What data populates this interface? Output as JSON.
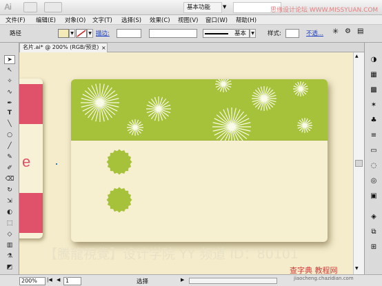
{
  "app": {
    "logo": "Ai",
    "workspace": "基本功能",
    "watermark_top": "思缘设计论坛 WWW.MISSYUAN.COM"
  },
  "menu": [
    "文件(F)",
    "编辑(E)",
    "对象(O)",
    "文字(T)",
    "选择(S)",
    "效果(C)",
    "视图(V)",
    "窗口(W)",
    "帮助(H)"
  ],
  "control": {
    "object_label": "路径",
    "stroke_label": "描边:",
    "stroke_profile": "基本",
    "style_label": "样式:",
    "opacity_label": "不透...",
    "fill_color": "#f4eab8",
    "stroke_color": "#cc2222"
  },
  "document": {
    "tab_title": "名片.ai* @ 200% (RGB/预览)",
    "close": "×"
  },
  "canvas": {
    "band_color": "#a6c23a",
    "card_color": "#f6efd0",
    "left_card_accent": "#e0526a",
    "left_card_letter": "e",
    "watermark": "【騰龍視覺】设计学院  YY 频道 ID：80101"
  },
  "status": {
    "zoom": "200%",
    "page": "1",
    "label": "选择"
  },
  "site_watermark": {
    "line1": "查字典 教程网",
    "line2": "jiaocheng.chazidian.com"
  }
}
